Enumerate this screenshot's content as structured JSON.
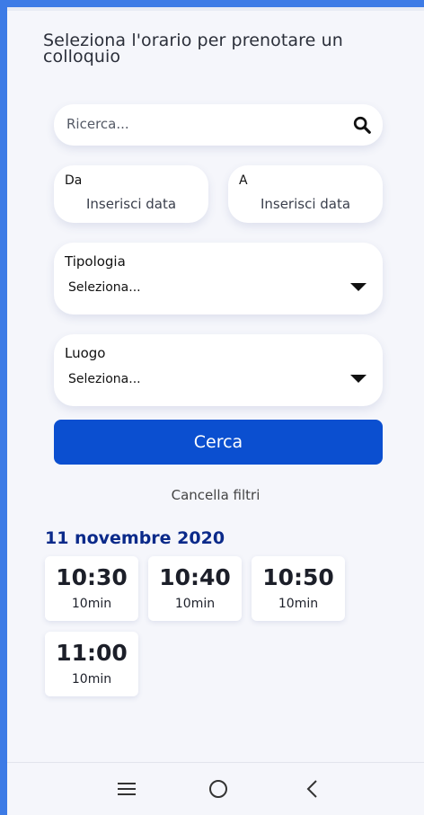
{
  "header": {
    "title": "Seleziona l'orario per prenotare un colloquio"
  },
  "search": {
    "placeholder": "Ricerca...",
    "icon": "search-icon"
  },
  "filters": {
    "from": {
      "label": "Da",
      "value": "Inserisci data"
    },
    "to": {
      "label": "A",
      "value": "Inserisci data"
    },
    "type": {
      "label": "Tipologia",
      "value": "Seleziona..."
    },
    "place": {
      "label": "Luogo",
      "value": "Seleziona..."
    }
  },
  "actions": {
    "search_label": "Cerca",
    "clear_label": "Cancella filtri"
  },
  "results": {
    "date": "11 novembre 2020",
    "slots": [
      {
        "time": "10:30",
        "duration": "10min"
      },
      {
        "time": "10:40",
        "duration": "10min"
      },
      {
        "time": "10:50",
        "duration": "10min"
      },
      {
        "time": "11:00",
        "duration": "10min"
      }
    ]
  },
  "navbar": {
    "icons": [
      "menu-icon",
      "home-icon",
      "back-icon"
    ]
  },
  "colors": {
    "primary": "#0b4fd0",
    "accent_title": "#0b2a8a",
    "frame": "#3d7be6"
  }
}
